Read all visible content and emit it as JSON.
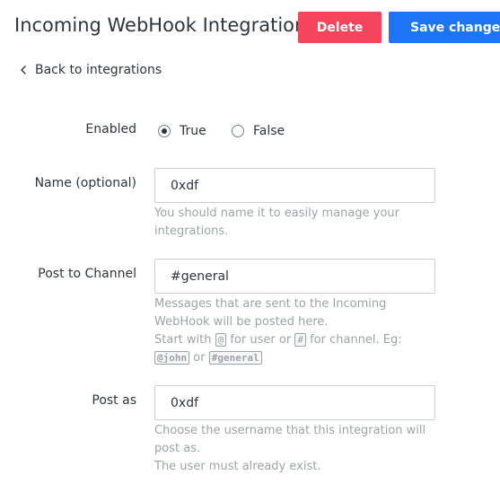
{
  "header": {
    "title": "Incoming WebHook Integration",
    "delete_label": "Delete",
    "save_label": "Save changes",
    "delete_color": "#f5455c",
    "save_color": "#1d74f5"
  },
  "back_link": {
    "label": "Back to integrations",
    "icon": "chevron-left-icon"
  },
  "form": {
    "enabled": {
      "label": "Enabled",
      "options": [
        "True",
        "False"
      ],
      "selected": "True"
    },
    "name": {
      "label": "Name (optional)",
      "value": "0xdf",
      "help": "You should name it to easily manage your integrations."
    },
    "channel": {
      "label": "Post to Channel",
      "value": "#general",
      "help1": "Messages that are sent to the Incoming WebHook will be posted here.",
      "help2_start": "Start with",
      "help2_at": "@",
      "help2_user": "for user or",
      "help2_hash": "#",
      "help2_channel": "for channel. Eg:",
      "example_user": "@john",
      "example_or": "or",
      "example_channel": "#general"
    },
    "post_as": {
      "label": "Post as",
      "value": "0xdf",
      "help1": "Choose the username that this integration will post as.",
      "help2": "The user must already exist."
    }
  }
}
